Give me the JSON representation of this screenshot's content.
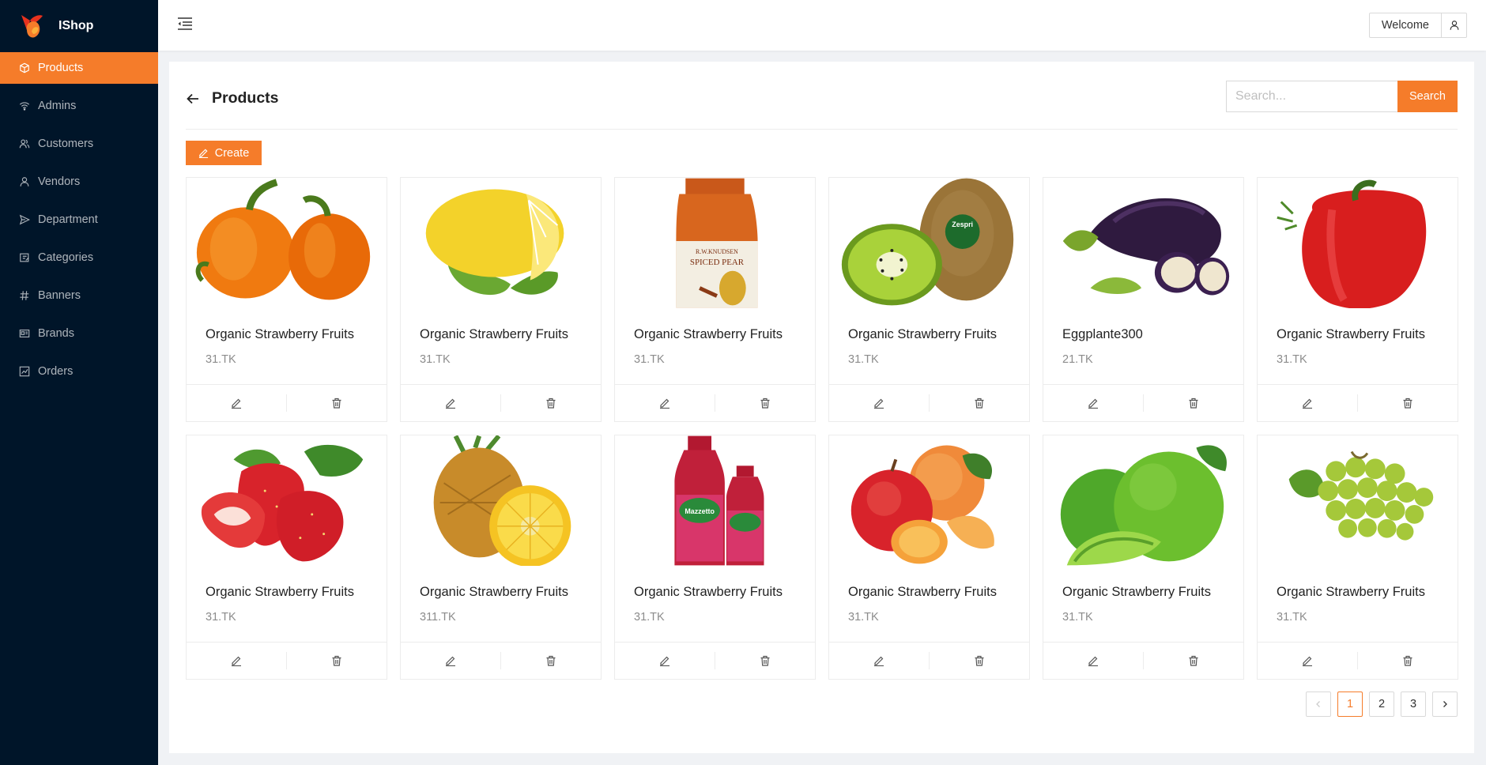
{
  "app": {
    "name": "IShop",
    "brand_color": "#f57c2a",
    "sidebar_bg": "#001529"
  },
  "sidebar": {
    "items": [
      {
        "label": "Products",
        "icon": "box-icon",
        "active": true
      },
      {
        "label": "Admins",
        "icon": "wifi-icon"
      },
      {
        "label": "Customers",
        "icon": "users-icon"
      },
      {
        "label": "Vendors",
        "icon": "user-icon"
      },
      {
        "label": "Department",
        "icon": "send-icon"
      },
      {
        "label": "Categories",
        "icon": "folder-icon"
      },
      {
        "label": "Banners",
        "icon": "hash-icon"
      },
      {
        "label": "Brands",
        "icon": "id-card-icon"
      },
      {
        "label": "Orders",
        "icon": "chart-icon"
      }
    ]
  },
  "header": {
    "welcome_label": "Welcome"
  },
  "page": {
    "title": "Products",
    "search_placeholder": "Search...",
    "search_button": "Search",
    "create_button": "Create"
  },
  "products": [
    {
      "name": "Organic Strawberry Fruits",
      "price": "31.TK",
      "image": "orange-pepper"
    },
    {
      "name": "Organic Strawberry Fruits",
      "price": "31.TK",
      "image": "lemon"
    },
    {
      "name": "Organic Strawberry Fruits",
      "price": "31.TK",
      "image": "spiced-pear-jar"
    },
    {
      "name": "Organic Strawberry Fruits",
      "price": "31.TK",
      "image": "kiwi"
    },
    {
      "name": "Eggplante300",
      "price": "21.TK",
      "image": "eggplant"
    },
    {
      "name": "Organic Strawberry Fruits",
      "price": "31.TK",
      "image": "red-pepper"
    },
    {
      "name": "Organic Strawberry Fruits",
      "price": "31.TK",
      "image": "strawberry"
    },
    {
      "name": "Organic Strawberry Fruits",
      "price": "311.TK",
      "image": "pineapple"
    },
    {
      "name": "Organic Strawberry Fruits",
      "price": "31.TK",
      "image": "raspberry-juice"
    },
    {
      "name": "Organic Strawberry Fruits",
      "price": "31.TK",
      "image": "peach-apple"
    },
    {
      "name": "Organic Strawberry Fruits",
      "price": "31.TK",
      "image": "lime"
    },
    {
      "name": "Organic Strawberry Fruits",
      "price": "31.TK",
      "image": "grapes"
    }
  ],
  "product_image_labels": {
    "jar_brand": "R.W.KNUDSEN",
    "jar_name": "SPICED PEAR",
    "kiwi_brand": "Zespri",
    "juice_brand": "Mazzetto"
  },
  "pagination": {
    "pages": [
      "1",
      "2",
      "3"
    ],
    "current": "1"
  }
}
